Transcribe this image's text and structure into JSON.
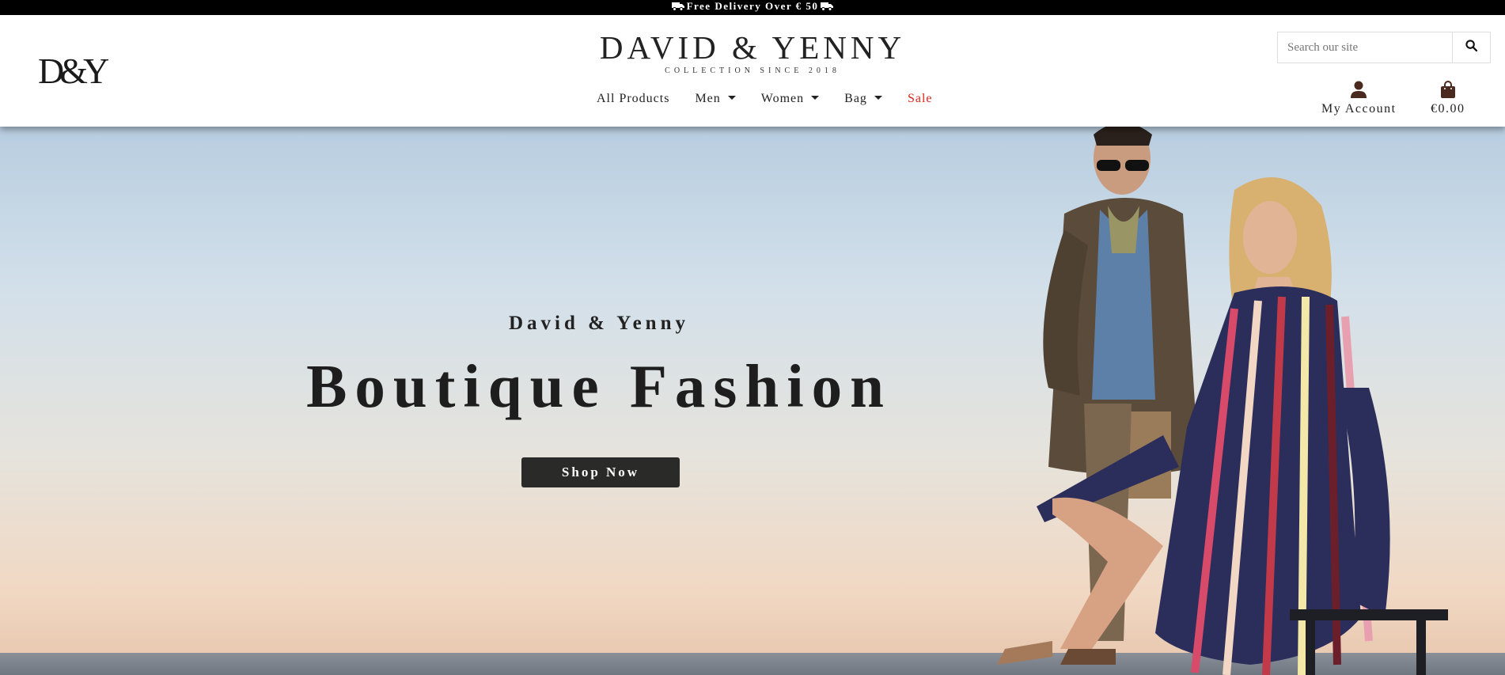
{
  "promo": {
    "text": "Free Delivery Over € 50",
    "icon": "truck-icon"
  },
  "header": {
    "logo_mark": "D&Y",
    "brand_title": "DAVID & YENNY",
    "brand_subtitle": "COLLECTION SINCE 2018",
    "nav": [
      {
        "label": "All Products",
        "dropdown": false
      },
      {
        "label": "Men",
        "dropdown": true
      },
      {
        "label": "Women",
        "dropdown": true
      },
      {
        "label": "Bag",
        "dropdown": true
      },
      {
        "label": "Sale",
        "dropdown": false,
        "color": "#e0241c"
      }
    ],
    "search": {
      "placeholder": "Search our site",
      "icon": "search-icon"
    },
    "account": {
      "label": "My Account",
      "icon": "user-icon"
    },
    "cart": {
      "label": "€0.00",
      "icon": "shopping-bag-icon"
    }
  },
  "hero": {
    "kicker": "David & Yenny",
    "title": "Boutique Fashion",
    "cta": "Shop Now"
  },
  "colors": {
    "promo_bg": "#000000",
    "sale": "#e0241c",
    "icon_brown": "#4a2a1e",
    "cta_bg": "#2a2a28"
  }
}
